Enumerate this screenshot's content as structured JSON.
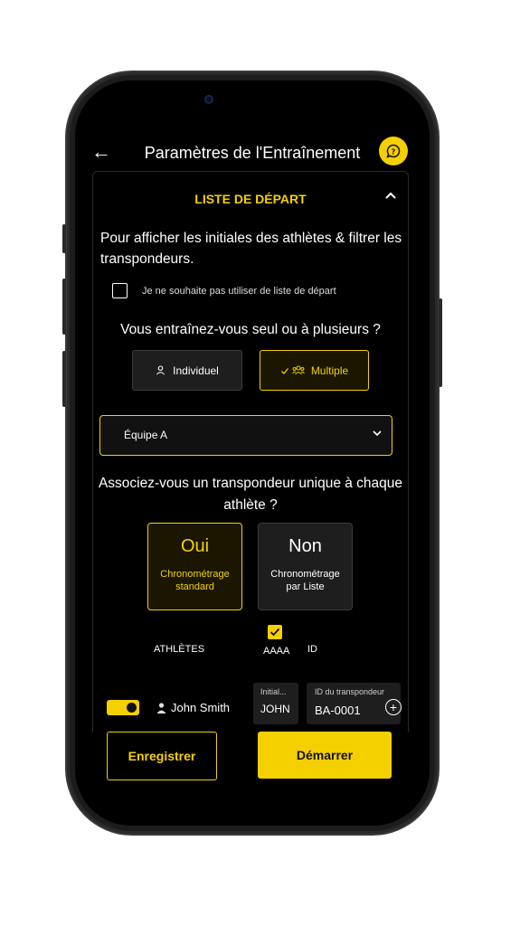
{
  "header": {
    "back_icon": "arrow-left-icon",
    "title": "Paramètres de l'Entraînement",
    "help_icon": "chat-help-icon"
  },
  "section": {
    "title": "LISTE DE DÉPART",
    "collapse_icon": "chevron-up-icon",
    "intro": "Pour afficher les initiales des athlètes & filtrer les transpondeurs.",
    "no_start_list_label": "Je ne souhaite pas utiliser de liste de départ"
  },
  "training_mode": {
    "question": "Vous entraînez-vous seul ou à plusieurs ?",
    "individual_label": "Individuel",
    "multiple_label": "Multiple",
    "selected": "Multiple"
  },
  "team_select": {
    "value": "Équipe A"
  },
  "transponder_question": {
    "question": "Associez-vous un transpondeur unique à chaque athlète ?",
    "yes": {
      "title": "Oui",
      "subtitle": "Chronométrage standard"
    },
    "no": {
      "title": "Non",
      "subtitle": "Chronométrage par Liste"
    },
    "selected": "Oui"
  },
  "athletes_table": {
    "athletes_label": "ATHLÈTES",
    "initials_col_label": "AAAA",
    "id_col_label": "ID",
    "rows": [
      {
        "enabled": true,
        "name": "John Smith",
        "initials_label": "Initial...",
        "initials": "JOHN",
        "transponder_label": "ID du transpondeur",
        "transponder": "BA-0001"
      }
    ]
  },
  "actions": {
    "save_label": "Enregistrer",
    "start_label": "Démarrer"
  },
  "colors": {
    "accent": "#f5d000",
    "background": "#000000",
    "surface": "#1e1e1e"
  }
}
